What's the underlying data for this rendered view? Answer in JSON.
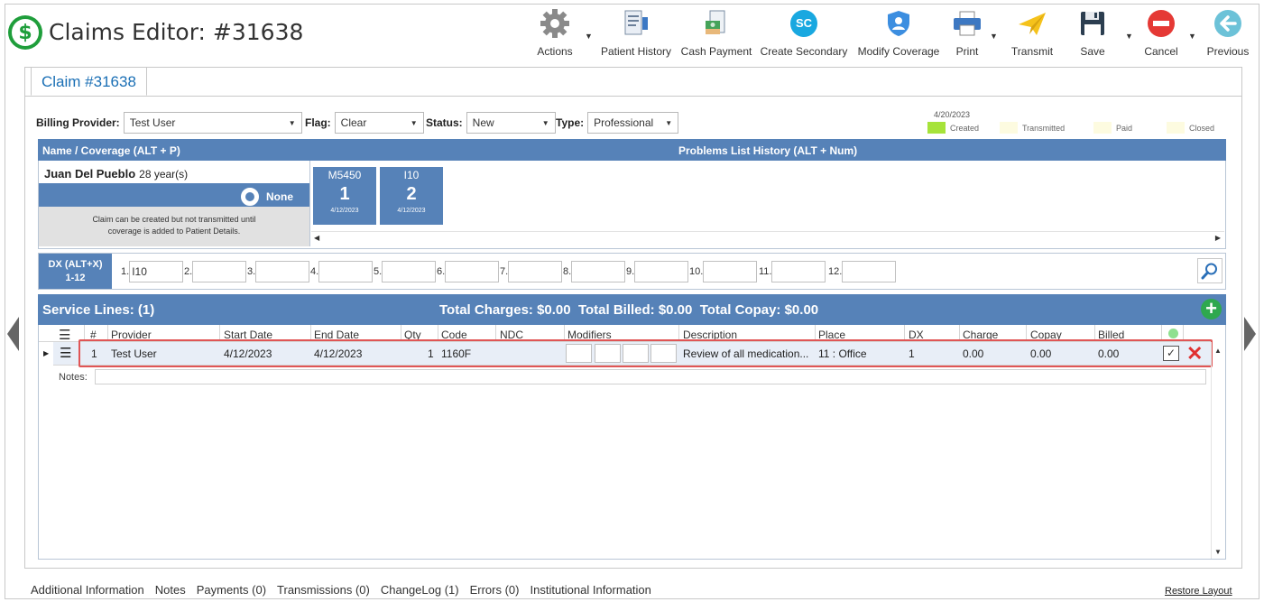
{
  "header": {
    "title": "Claims Editor: #31638",
    "logo_glyph": "$"
  },
  "toolbar": [
    {
      "id": "actions",
      "label": "Actions",
      "icon": "gear-icon"
    },
    {
      "id": "patient_history",
      "label": "Patient History",
      "icon": "patient-history-icon"
    },
    {
      "id": "cash_payment",
      "label": "Cash Payment",
      "icon": "cash-payment-icon"
    },
    {
      "id": "create_secondary",
      "label": "Create Secondary",
      "icon": "sc-badge-icon",
      "badge": "SC"
    },
    {
      "id": "modify_coverage",
      "label": "Modify Coverage",
      "icon": "shield-icon"
    },
    {
      "id": "print",
      "label": "Print",
      "icon": "printer-icon"
    },
    {
      "id": "transmit",
      "label": "Transmit",
      "icon": "paper-plane-icon"
    },
    {
      "id": "save",
      "label": "Save",
      "icon": "floppy-disk-icon"
    },
    {
      "id": "cancel",
      "label": "Cancel",
      "icon": "no-entry-icon"
    },
    {
      "id": "previous",
      "label": "Previous",
      "icon": "arrow-left-circle-icon"
    }
  ],
  "tab": {
    "label": "Claim #31638"
  },
  "fields": {
    "billing_provider": {
      "label": "Billing Provider:",
      "value": "Test User"
    },
    "flag": {
      "label": "Flag:",
      "value": "Clear"
    },
    "status": {
      "label": "Status:",
      "value": "New"
    },
    "type": {
      "label": "Type:",
      "value": "Professional"
    }
  },
  "status_legend": {
    "date": "4/20/2023",
    "items": [
      {
        "label": "Created",
        "color": "#a6e33a"
      },
      {
        "label": "Transmitted",
        "color": "#fdfbe0"
      },
      {
        "label": "Paid",
        "color": "#fdfbe0"
      },
      {
        "label": "Closed",
        "color": "#fdfbe0"
      }
    ]
  },
  "patient": {
    "bar_left": "Name / Coverage (ALT + P)",
    "bar_center": "Problems List History (ALT + Num)",
    "name": "Juan Del Pueblo",
    "age": "28 year(s)",
    "coverage": "None",
    "message": "Claim can be created but not transmitted until coverage is added to Patient Details."
  },
  "problems": [
    {
      "code": "M5450",
      "number": "1",
      "date": "4/12/2023"
    },
    {
      "code": "I10",
      "number": "2",
      "date": "4/12/2023"
    }
  ],
  "dx": {
    "label_line1": "DX (ALT+X)",
    "label_line2": "1-12",
    "codes": [
      {
        "n": "1.",
        "v": "I10"
      },
      {
        "n": "2.",
        "v": ""
      },
      {
        "n": "3.",
        "v": ""
      },
      {
        "n": "4.",
        "v": ""
      },
      {
        "n": "5.",
        "v": ""
      },
      {
        "n": "6.",
        "v": ""
      },
      {
        "n": "7.",
        "v": ""
      },
      {
        "n": "8.",
        "v": ""
      },
      {
        "n": "9.",
        "v": ""
      },
      {
        "n": "10.",
        "v": ""
      },
      {
        "n": "11.",
        "v": ""
      },
      {
        "n": "12.",
        "v": ""
      }
    ]
  },
  "service": {
    "title": "Service Lines: (1)",
    "totals": "Total Charges: $0.00  Total Billed: $0.00  Total Copay: $0.00",
    "columns": [
      "#",
      "Provider",
      "Start Date",
      "End Date",
      "Qty",
      "Code",
      "NDC",
      "Modifiers",
      "Description",
      "Place",
      "DX",
      "Charge",
      "Copay",
      "Billed"
    ],
    "rows": [
      {
        "num": "1",
        "provider": "Test User",
        "start": "4/12/2023",
        "end": "4/12/2023",
        "qty": "1",
        "code": "1160F",
        "ndc": "",
        "description": "Review of all medication...",
        "place": "11 : Office",
        "dx": "1",
        "charge": "0.00",
        "copay": "0.00",
        "billed": "0.00"
      }
    ],
    "notes_label": "Notes:"
  },
  "bottom_tabs": [
    "Additional Information",
    "Notes",
    "Payments (0)",
    "Transmissions (0)",
    "ChangeLog (1)",
    "Errors (0)",
    "Institutional Information"
  ],
  "restore_layout": "Restore Layout"
}
